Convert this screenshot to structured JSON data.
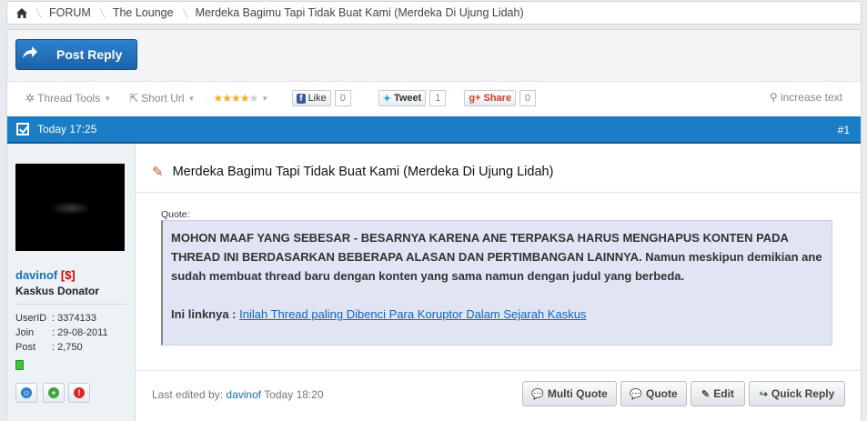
{
  "breadcrumb": {
    "items": [
      {
        "label": "FORUM"
      },
      {
        "label": "The Lounge"
      },
      {
        "label": "Merdeka Bagimu Tapi Tidak Buat Kami (Merdeka Di Ujung Lidah)"
      }
    ]
  },
  "toolbar": {
    "post_reply_label": "Post Reply",
    "thread_tools_label": "Thread Tools",
    "short_url_label": "Short Url",
    "rating_stars": 4,
    "rating_max": 5,
    "facebook_label": "Like",
    "facebook_count": "0",
    "twitter_label": "Tweet",
    "twitter_count": "1",
    "gplus_label": "Share",
    "gplus_count": "0",
    "increase_text_label": "increase text"
  },
  "post": {
    "date": "Today 17:25",
    "number": "#1",
    "title": "Merdeka Bagimu Tapi Tidak Buat Kami (Merdeka Di Ujung Lidah)",
    "quote_label": "Quote:",
    "quote_bold": "MOHON MAAF YANG SEBESAR - BESARNYA KARENA ANE TERPAKSA HARUS MENGHAPUS KONTEN PADA THREAD INI BERDASARKAN BEBERAPA ALASAN DAN PERTIMBANGAN LAINNYA. Namun meskipun demikian ane sudah membuat thread baru dengan konten yang sama namun dengan judul yang berbeda.",
    "link_prefix": "Ini linknya : ",
    "link_text": "Inilah Thread paling Dibenci Para Koruptor Dalam Sejarah Kaskus",
    "edited_prefix": "Last edited by: ",
    "edited_user": "davinof",
    "edited_time": " Today 18:20",
    "buttons": {
      "multi_quote": "Multi Quote",
      "quote": "Quote",
      "edit": "Edit",
      "quick_reply": "Quick Reply"
    }
  },
  "user": {
    "name": "davinof",
    "donator_badge": "[$]",
    "title": "Kaskus Donator",
    "stats": [
      {
        "key": "UserID",
        "value": ": 3374133"
      },
      {
        "key": "Join",
        "value": ": 29-08-2011"
      },
      {
        "key": "Post",
        "value": ": 2,750"
      }
    ]
  },
  "colors": {
    "accent_blue": "#1a7dc5",
    "button_blue": "#1b62a8",
    "quote_bg": "#e1e5f3",
    "online_green": "#3ec43e"
  }
}
